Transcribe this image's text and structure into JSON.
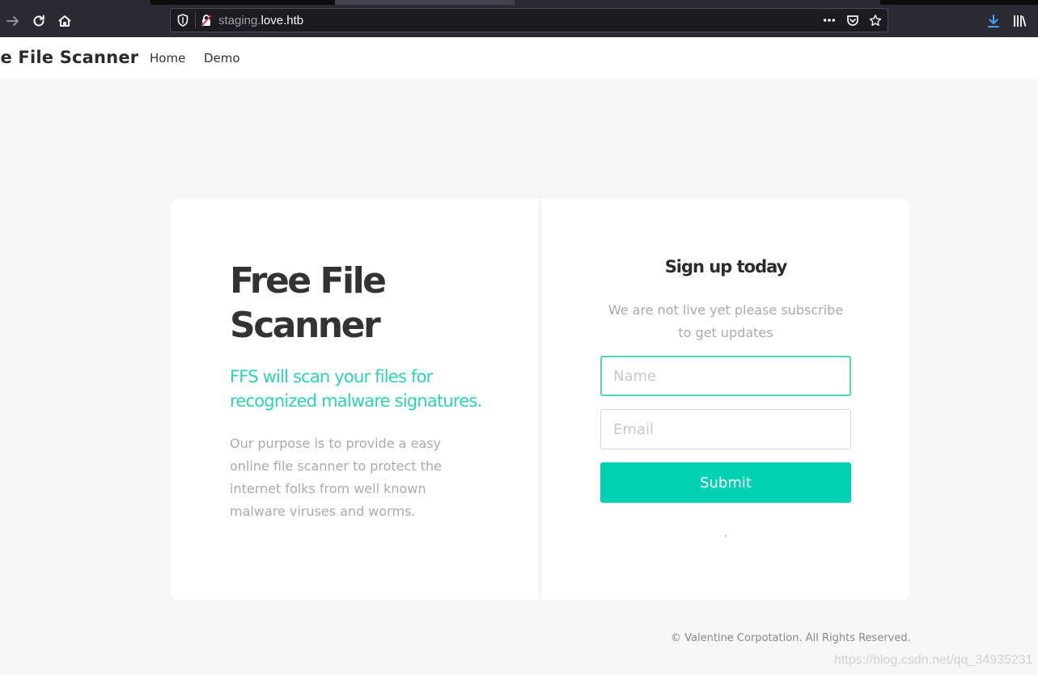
{
  "browser": {
    "url_subdomain": "staging.",
    "url_domain": "love.htb",
    "icons": {
      "forward": "forward-arrow-icon",
      "reload": "reload-icon",
      "home": "home-icon",
      "tracking": "shield-icon",
      "insecure": "insecure-lock-icon",
      "more": "more-dots-icon",
      "pocket": "pocket-icon",
      "bookmark": "star-icon",
      "downloads": "download-icon",
      "library": "library-icon"
    }
  },
  "site_nav": {
    "brand": "ee File Scanner",
    "links": [
      "Home",
      "Demo"
    ]
  },
  "hero": {
    "title": "Free File Scanner",
    "subtitle": "FFS will scan your files for recognized malware signatures.",
    "description": "Our purpose is to provide a easy online file scanner to protect the internet folks from well known malware viruses and worms."
  },
  "signup": {
    "title": "Sign up today",
    "subtitle": "We are not live yet please subscribe to get updates",
    "name_placeholder": "Name",
    "email_placeholder": "Email",
    "submit_label": "Submit"
  },
  "footer": {
    "copyright": "© Valentine Corpotation. All Rights Reserved."
  },
  "watermark": "https://blog.csdn.net/qq_34935231",
  "colors": {
    "accent": "#00d1b2",
    "subtitle": "#2ad4b3"
  }
}
